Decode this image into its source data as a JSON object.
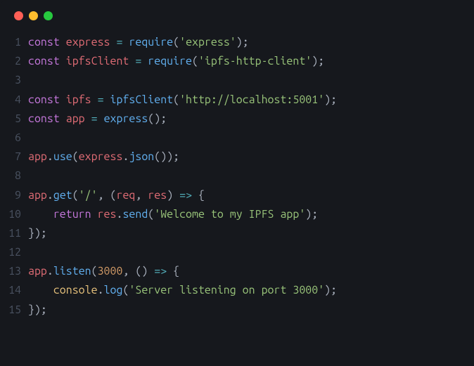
{
  "traffic_lights": [
    "red",
    "yellow",
    "green"
  ],
  "code": {
    "lines": [
      {
        "n": 1,
        "tokens": [
          {
            "t": "const ",
            "c": "kw"
          },
          {
            "t": "express",
            "c": "var"
          },
          {
            "t": " ",
            "c": "pn"
          },
          {
            "t": "=",
            "c": "op"
          },
          {
            "t": " ",
            "c": "pn"
          },
          {
            "t": "require",
            "c": "fn"
          },
          {
            "t": "(",
            "c": "pn"
          },
          {
            "t": "'express'",
            "c": "str"
          },
          {
            "t": ")",
            "c": "pn"
          },
          {
            "t": ";",
            "c": "pn"
          }
        ]
      },
      {
        "n": 2,
        "tokens": [
          {
            "t": "const ",
            "c": "kw"
          },
          {
            "t": "ipfsClient",
            "c": "var"
          },
          {
            "t": " ",
            "c": "pn"
          },
          {
            "t": "=",
            "c": "op"
          },
          {
            "t": " ",
            "c": "pn"
          },
          {
            "t": "require",
            "c": "fn"
          },
          {
            "t": "(",
            "c": "pn"
          },
          {
            "t": "'ipfs-http-client'",
            "c": "str"
          },
          {
            "t": ")",
            "c": "pn"
          },
          {
            "t": ";",
            "c": "pn"
          }
        ]
      },
      {
        "n": 3,
        "tokens": []
      },
      {
        "n": 4,
        "tokens": [
          {
            "t": "const ",
            "c": "kw"
          },
          {
            "t": "ipfs",
            "c": "var"
          },
          {
            "t": " ",
            "c": "pn"
          },
          {
            "t": "=",
            "c": "op"
          },
          {
            "t": " ",
            "c": "pn"
          },
          {
            "t": "ipfsClient",
            "c": "fn"
          },
          {
            "t": "(",
            "c": "pn"
          },
          {
            "t": "'http://localhost:5001'",
            "c": "str"
          },
          {
            "t": ")",
            "c": "pn"
          },
          {
            "t": ";",
            "c": "pn"
          }
        ]
      },
      {
        "n": 5,
        "tokens": [
          {
            "t": "const ",
            "c": "kw"
          },
          {
            "t": "app",
            "c": "var"
          },
          {
            "t": " ",
            "c": "pn"
          },
          {
            "t": "=",
            "c": "op"
          },
          {
            "t": " ",
            "c": "pn"
          },
          {
            "t": "express",
            "c": "fn"
          },
          {
            "t": "()",
            "c": "pn"
          },
          {
            "t": ";",
            "c": "pn"
          }
        ]
      },
      {
        "n": 6,
        "tokens": []
      },
      {
        "n": 7,
        "tokens": [
          {
            "t": "app",
            "c": "var"
          },
          {
            "t": ".",
            "c": "pn"
          },
          {
            "t": "use",
            "c": "fn"
          },
          {
            "t": "(",
            "c": "pn"
          },
          {
            "t": "express",
            "c": "var"
          },
          {
            "t": ".",
            "c": "pn"
          },
          {
            "t": "json",
            "c": "fn"
          },
          {
            "t": "())",
            "c": "pn"
          },
          {
            "t": ";",
            "c": "pn"
          }
        ]
      },
      {
        "n": 8,
        "tokens": []
      },
      {
        "n": 9,
        "tokens": [
          {
            "t": "app",
            "c": "var"
          },
          {
            "t": ".",
            "c": "pn"
          },
          {
            "t": "get",
            "c": "fn"
          },
          {
            "t": "(",
            "c": "pn"
          },
          {
            "t": "'/'",
            "c": "str"
          },
          {
            "t": ", (",
            "c": "pn"
          },
          {
            "t": "req",
            "c": "var"
          },
          {
            "t": ", ",
            "c": "pn"
          },
          {
            "t": "res",
            "c": "var"
          },
          {
            "t": ") ",
            "c": "pn"
          },
          {
            "t": "=>",
            "c": "op"
          },
          {
            "t": " {",
            "c": "pn"
          }
        ]
      },
      {
        "n": 10,
        "tokens": [
          {
            "t": "    ",
            "c": "pn"
          },
          {
            "t": "return ",
            "c": "kw"
          },
          {
            "t": "res",
            "c": "var"
          },
          {
            "t": ".",
            "c": "pn"
          },
          {
            "t": "send",
            "c": "fn"
          },
          {
            "t": "(",
            "c": "pn"
          },
          {
            "t": "'Welcome to my IPFS app'",
            "c": "str"
          },
          {
            "t": ")",
            "c": "pn"
          },
          {
            "t": ";",
            "c": "pn"
          }
        ]
      },
      {
        "n": 11,
        "tokens": [
          {
            "t": "})",
            "c": "pn"
          },
          {
            "t": ";",
            "c": "pn"
          }
        ]
      },
      {
        "n": 12,
        "tokens": []
      },
      {
        "n": 13,
        "tokens": [
          {
            "t": "app",
            "c": "var"
          },
          {
            "t": ".",
            "c": "pn"
          },
          {
            "t": "listen",
            "c": "fn"
          },
          {
            "t": "(",
            "c": "pn"
          },
          {
            "t": "3000",
            "c": "num"
          },
          {
            "t": ", () ",
            "c": "pn"
          },
          {
            "t": "=>",
            "c": "op"
          },
          {
            "t": " {",
            "c": "pn"
          }
        ]
      },
      {
        "n": 14,
        "tokens": [
          {
            "t": "    ",
            "c": "pn"
          },
          {
            "t": "console",
            "c": "id"
          },
          {
            "t": ".",
            "c": "pn"
          },
          {
            "t": "log",
            "c": "fn"
          },
          {
            "t": "(",
            "c": "pn"
          },
          {
            "t": "'Server listening on port 3000'",
            "c": "str"
          },
          {
            "t": ")",
            "c": "pn"
          },
          {
            "t": ";",
            "c": "pn"
          }
        ]
      },
      {
        "n": 15,
        "tokens": [
          {
            "t": "})",
            "c": "pn"
          },
          {
            "t": ";",
            "c": "pn"
          }
        ]
      }
    ]
  }
}
